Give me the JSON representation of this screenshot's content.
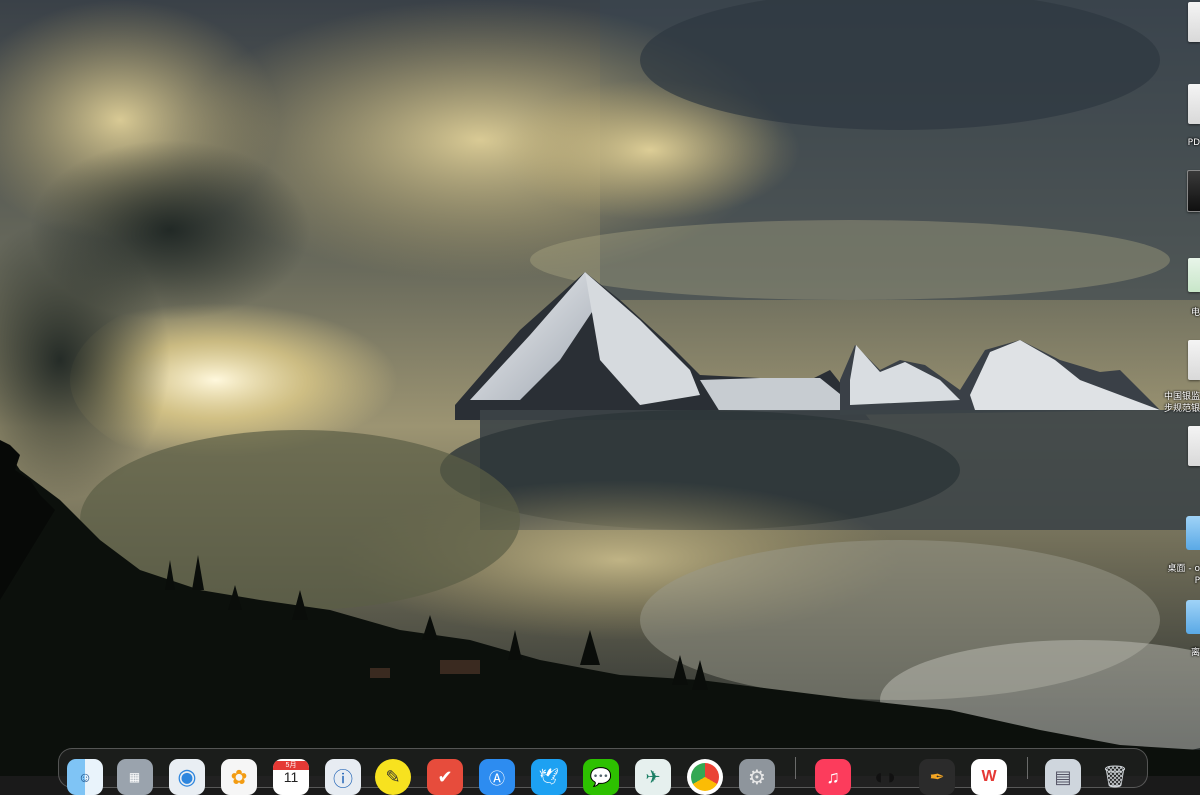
{
  "desktop": {
    "items": [
      {
        "id": "doc-1",
        "label": ""
      },
      {
        "id": "pdf-doc",
        "label": "PD"
      },
      {
        "id": "video-file",
        "label": ""
      },
      {
        "id": "spreadsheet",
        "label": "电"
      },
      {
        "id": "bank-doc",
        "label_line1": "中国银监",
        "label_line2": "步规范银"
      },
      {
        "id": "doc-2",
        "label": ""
      },
      {
        "id": "folder-desktop",
        "label_line1": "桌面 - o",
        "label_line2": "P"
      },
      {
        "id": "folder-2",
        "label": "离"
      }
    ]
  },
  "dock": {
    "calendar": {
      "month": "5月",
      "day": "11"
    },
    "apps": [
      {
        "name": "finder",
        "icon": "finder-icon"
      },
      {
        "name": "launchpad",
        "icon": "launchpad-icon"
      },
      {
        "name": "safari",
        "icon": "safari-icon"
      },
      {
        "name": "photos",
        "icon": "photos-icon"
      },
      {
        "name": "calendar",
        "icon": "calendar-icon"
      },
      {
        "name": "1password",
        "icon": "1password-icon"
      },
      {
        "name": "notes-pen",
        "icon": "pen-icon"
      },
      {
        "name": "tasks",
        "icon": "checkmark-icon"
      },
      {
        "name": "app-store",
        "icon": "app-store-icon"
      },
      {
        "name": "twitter",
        "icon": "bird-icon"
      },
      {
        "name": "wechat",
        "icon": "wechat-icon"
      },
      {
        "name": "mail-app",
        "icon": "mail-icon"
      },
      {
        "name": "chrome",
        "icon": "chrome-icon"
      },
      {
        "name": "system-preferences",
        "icon": "gear-icon"
      },
      {
        "name": "music",
        "icon": "music-icon"
      },
      {
        "name": "qq",
        "icon": "penguin-icon"
      },
      {
        "name": "sketch-tool",
        "icon": "feather-icon"
      },
      {
        "name": "wps",
        "icon": "wps-icon"
      },
      {
        "name": "files",
        "icon": "files-icon"
      },
      {
        "name": "trash",
        "icon": "trash-icon"
      }
    ]
  },
  "colors": {
    "sky_dark": "#2b3540",
    "sky_gold": "#e6d59a",
    "snow": "#eef0f2",
    "forest": "#0b0f0a"
  }
}
